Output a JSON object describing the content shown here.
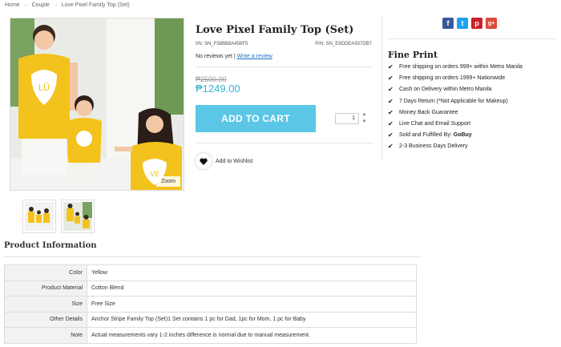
{
  "breadcrumb": {
    "items": [
      "Home",
      "Couple",
      "Love Pixel Family Top (Set)"
    ],
    "separator": "→"
  },
  "gallery": {
    "zoom_label": "Zoom",
    "shirt_color": "#f4c21c",
    "shirt_text_main_left": "LŪ",
    "shirt_text_main_right": "VE"
  },
  "product": {
    "title": "Love Pixel Family Top (Set)",
    "item_no": "I/N: SN_F58BB8A456F5",
    "part_no": "P/N: SN_E9DDEA937DB7",
    "no_reviews": "No reviews yet",
    "review_separator": "|",
    "write_review": "Write a review",
    "old_price": "₱2500.00",
    "new_price": "₱1249.00",
    "add_to_cart": "ADD TO CART",
    "quantity": "1",
    "wishlist": "Add to Wishlist",
    "price_color": "#3ab0d6",
    "button_color": "#5bc6e5"
  },
  "social": {
    "facebook": "f",
    "twitter": "t",
    "pinterest": "p",
    "googleplus": "g+"
  },
  "fine_print": {
    "title": "Fine Print",
    "items": [
      "Free shipping on orders 999+ within Metro Manila",
      "Free shipping on orders 1999+ Nationwide",
      "Cash on Delivery within Metro Manila",
      "7 Days Return (*Not Applicable for Makeup)",
      "Money Back Guarantee",
      "Live Chat and Email Support",
      "Sold and Fulfilled By:",
      "2-3 Business Days Delivery"
    ],
    "seller": "GoBuy"
  },
  "product_info": {
    "title": "Product Information",
    "rows": [
      {
        "key": "Color",
        "value": "Yellow"
      },
      {
        "key": "Product Material",
        "value": "Cotton Blend"
      },
      {
        "key": "Size",
        "value": "Free Size"
      },
      {
        "key": "Other Details",
        "value": "Anchor Stripe Family Top (Set)1 Set contains 1 pc for Dad, 1pc for Mom, 1 pc for Baby"
      },
      {
        "key": "Note",
        "value": "Actual measurements vary 1-2 inches difference is normal due to manual measurement."
      }
    ]
  }
}
